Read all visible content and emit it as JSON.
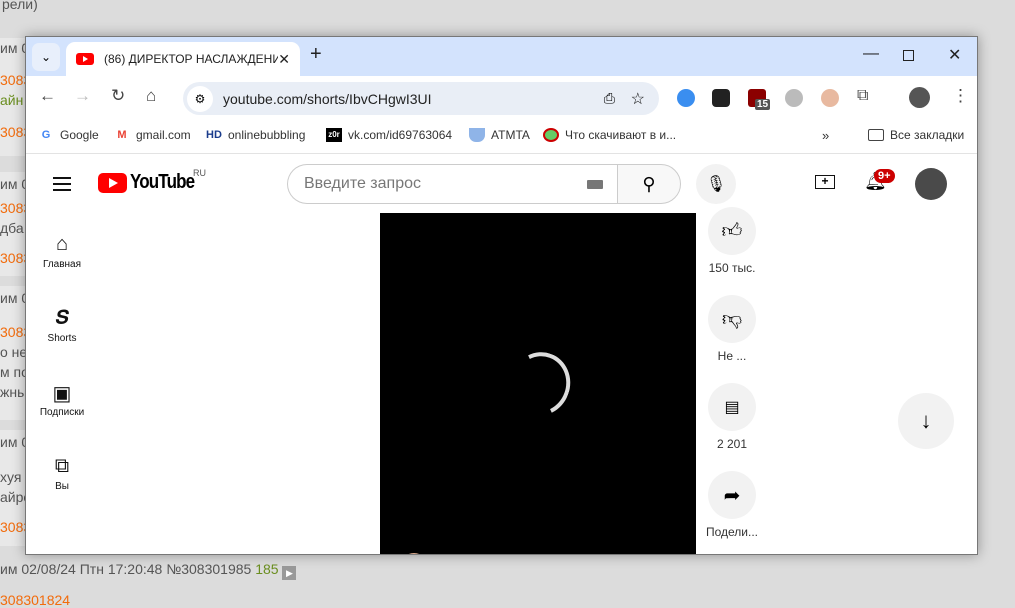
{
  "background_page": {
    "top_fragment": "рели)",
    "fragments": [
      {
        "text": "им 0",
        "kind": "meta"
      },
      {
        "text": "3083",
        "kind": "link"
      },
      {
        "text": "айн",
        "kind": "green"
      },
      {
        "text": "30830",
        "kind": "link"
      },
      {
        "text": "им 0",
        "kind": "meta"
      },
      {
        "text": "3083",
        "kind": "link"
      },
      {
        "text": "дба",
        "kind": "meta"
      },
      {
        "text": "30830",
        "kind": "link"
      },
      {
        "text": "им 0",
        "kind": "meta"
      },
      {
        "text": "3083",
        "kind": "link"
      },
      {
        "text": "о не",
        "kind": "meta"
      },
      {
        "text": "м по",
        "kind": "meta"
      },
      {
        "text": "жны",
        "kind": "meta"
      },
      {
        "text": "им 0",
        "kind": "meta"
      },
      {
        "text": "хуя",
        "kind": "meta"
      },
      {
        "text": "айро",
        "kind": "meta"
      },
      {
        "text": "30830",
        "kind": "link"
      }
    ],
    "bottom_post": {
      "meta": "им 02/08/24 Птн 17:20:48 №308301985",
      "count": "185",
      "reply": "308301824"
    }
  },
  "browser": {
    "tab_title": "(86) ДИРЕКТОР НАСЛАЖДЕНИ",
    "url": "youtube.com/shorts/IbvCHgwI3UI",
    "extension_badge": "15",
    "bookmarks": [
      {
        "label": "Google",
        "icon": "G"
      },
      {
        "label": "gmail.com",
        "icon": "M"
      },
      {
        "label": "onlinebubbling",
        "icon": "HD"
      },
      {
        "label": "vk.com/id69763064",
        "icon": "z0r"
      },
      {
        "label": "ATMTA",
        "icon": "shield"
      },
      {
        "label": "Что скачивают в и...",
        "icon": "no"
      }
    ],
    "all_bookmarks": "Все закладки"
  },
  "youtube": {
    "region": "RU",
    "logo_text": "YouTube",
    "search_placeholder": "Введите запрос",
    "notifications": "9+",
    "nav": [
      {
        "label": "Главная",
        "icon": "home-icon"
      },
      {
        "label": "Shorts",
        "icon": "shorts-icon"
      },
      {
        "label": "Подписки",
        "icon": "subscriptions-icon"
      },
      {
        "label": "Вы",
        "icon": "you-icon"
      }
    ],
    "actions": {
      "likes": "150 тыс.",
      "dislike": "Не ...",
      "comments": "2 201",
      "share": "Подели..."
    }
  },
  "colors": {
    "tabstrip": "#d3e3fd",
    "youtube_red": "#ff0000",
    "link_orange": "#f26b0b"
  }
}
